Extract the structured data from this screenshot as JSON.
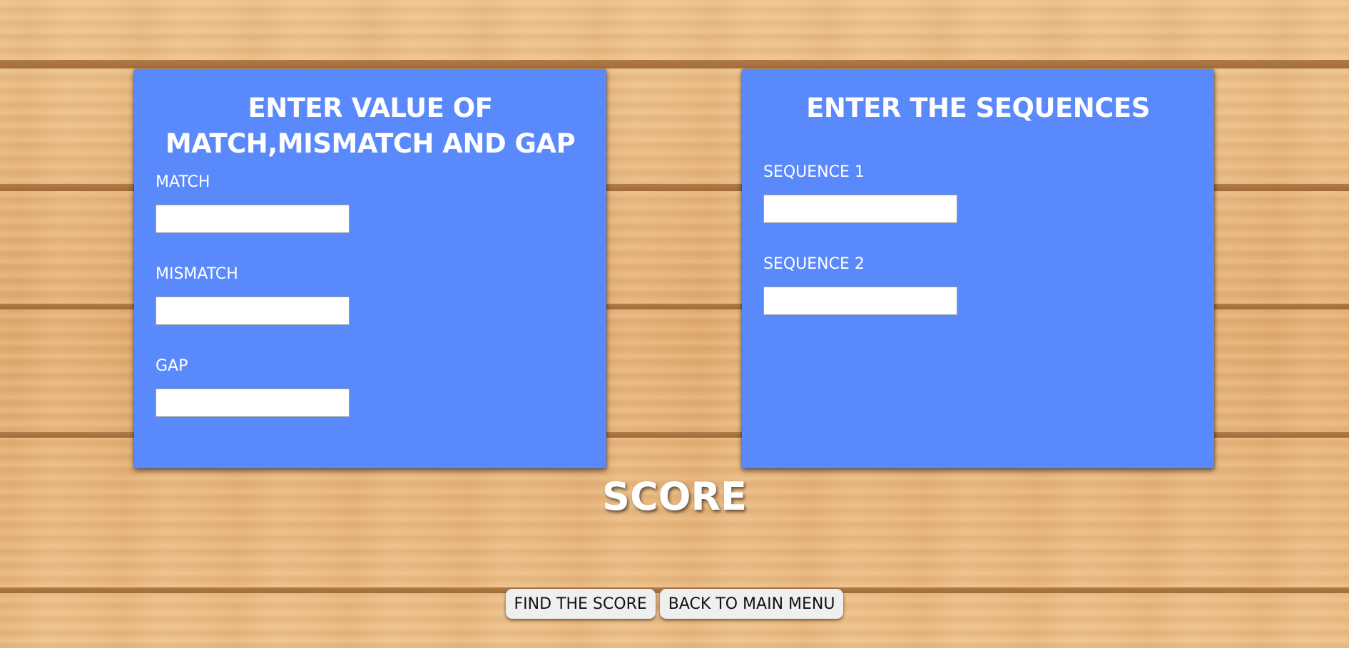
{
  "values_panel": {
    "title": "ENTER VALUE OF MATCH,MISMATCH AND GAP",
    "fields": [
      {
        "label": "MATCH",
        "value": ""
      },
      {
        "label": "MISMATCH",
        "value": ""
      },
      {
        "label": "GAP",
        "value": ""
      }
    ]
  },
  "sequences_panel": {
    "title": "ENTER THE SEQUENCES",
    "fields": [
      {
        "label": "SEQUENCE 1",
        "value": ""
      },
      {
        "label": "SEQUENCE 2",
        "value": ""
      }
    ]
  },
  "score": {
    "heading": "SCORE"
  },
  "actions": {
    "find_score_label": "FIND THE SCORE",
    "back_label": "BACK TO MAIN MENU"
  },
  "colors": {
    "panel": "#5989fb",
    "wood": "#e6b67e",
    "button": "#efefef"
  }
}
